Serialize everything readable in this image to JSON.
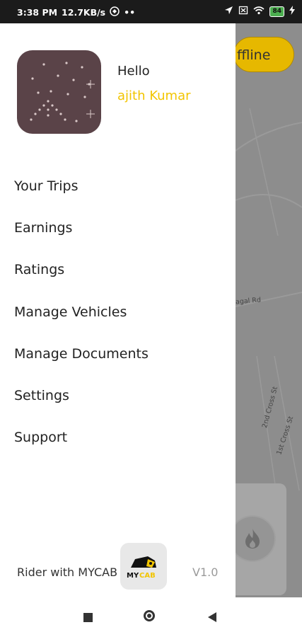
{
  "status_bar": {
    "time": "3:38 PM",
    "speed": "12.7KB/s",
    "dots": "••",
    "battery": "84"
  },
  "map": {
    "offline_label": "ffline",
    "road_labels": [
      "agal Rd",
      "2nd Cross St",
      "1st Cross St"
    ]
  },
  "drawer": {
    "greeting": "Hello",
    "user_name": "ajith Kumar",
    "menu": [
      {
        "label": "Your Trips"
      },
      {
        "label": "Earnings"
      },
      {
        "label": "Ratings"
      },
      {
        "label": "Manage Vehicles"
      },
      {
        "label": "Manage Documents"
      },
      {
        "label": "Settings"
      },
      {
        "label": "Support"
      }
    ],
    "footer_text": "Rider with MYCAB",
    "logo_text": "MYCAB",
    "version": "V1.0"
  },
  "colors": {
    "accent": "#f2c500",
    "offline_button": "#e6b800"
  }
}
